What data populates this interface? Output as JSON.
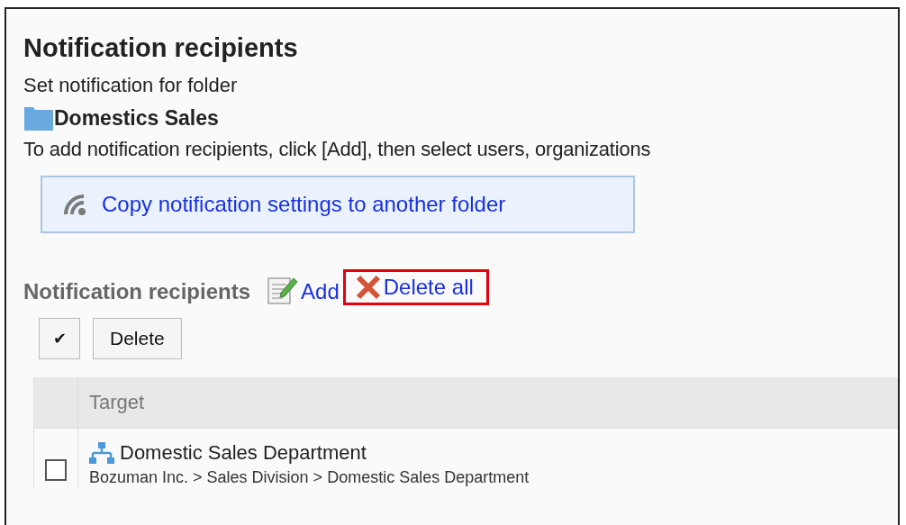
{
  "title": "Notification recipients",
  "subtitle": "Set notification for folder",
  "folder": {
    "name": "Domestics Sales"
  },
  "instruction": "To add notification recipients, click [Add], then select users, organizations",
  "copy_button": {
    "label": "Copy notification settings to another folder"
  },
  "section": {
    "title": "Notification recipients",
    "actions": [
      {
        "kind": "add",
        "label": "Add",
        "highlighted": false
      },
      {
        "kind": "delete_all",
        "label": "Delete all",
        "highlighted": true
      }
    ]
  },
  "toolbar": {
    "select_all": {
      "label": "✔"
    },
    "delete_button": {
      "label": "Delete"
    }
  },
  "table": {
    "columns": [
      "Target"
    ],
    "rows": [
      {
        "checked": false,
        "name": "Domestic Sales Department",
        "path": "Bozuman Inc. > Sales Division > Domestic Sales Department"
      }
    ]
  }
}
